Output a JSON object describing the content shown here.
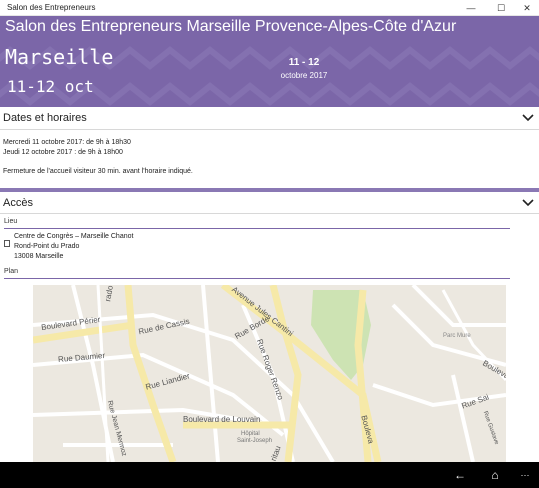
{
  "window": {
    "title": "Salon des Entrepreneurs",
    "minimize": "—",
    "maximize": "☐",
    "close": "✕"
  },
  "banner": {
    "headline": "Salon des Entrepreneurs Marseille Provence-Alpes-Côte d'Azur",
    "city": "Marseille",
    "city_dates": "11-12 oct",
    "days": "11 - 12",
    "month": "octobre 2017",
    "color": "#7b66a8"
  },
  "dates": {
    "title": "Dates et horaires",
    "line1": "Mercredi 11 octobre 2017: de 9h à 18h30",
    "line2": "Jeudi 12 octobre 2017 : de 9h à 18h00",
    "note": "Fermeture de l'accueil visiteur 30 min. avant l'horaire indiqué."
  },
  "acces": {
    "title": "Accès",
    "lieu_label": "Lieu",
    "address_line1": "Centre de Congrès – Marseille Chanot",
    "address_line2": "Rond-Point du Prado",
    "address_line3": "13008 Marseille",
    "plan_label": "Plan"
  },
  "map": {
    "labels": {
      "radio": "rado",
      "boulevard_perier": "Boulevard Périer",
      "rue_de_cassis": "Rue de Cassis",
      "rue_borde": "Rue Borde",
      "rue_daumier": "Rue Daumier",
      "rue_liandier": "Rue Liandier",
      "rue_roger_renzo": "Rue Roger Renzo",
      "avenue_jules_cantini": "Avenue Jules Cantini",
      "boulevard_de_louvain": "Boulevard de Louvain",
      "hopital": "Hôpital",
      "saint_joseph": "Saint-Joseph",
      "rue_mermoz": "Rue Jean Mermoz",
      "parc_mure": "Parc Mure",
      "boulevard_right": "Boulevard",
      "rue_saint": "Rue Sai",
      "rue_gustave": "Rue Gustave",
      "ritau": "ritau",
      "bouleva": "Bouleva"
    }
  },
  "taskbar": {
    "back": "←",
    "home": "⌂",
    "more": "···"
  }
}
